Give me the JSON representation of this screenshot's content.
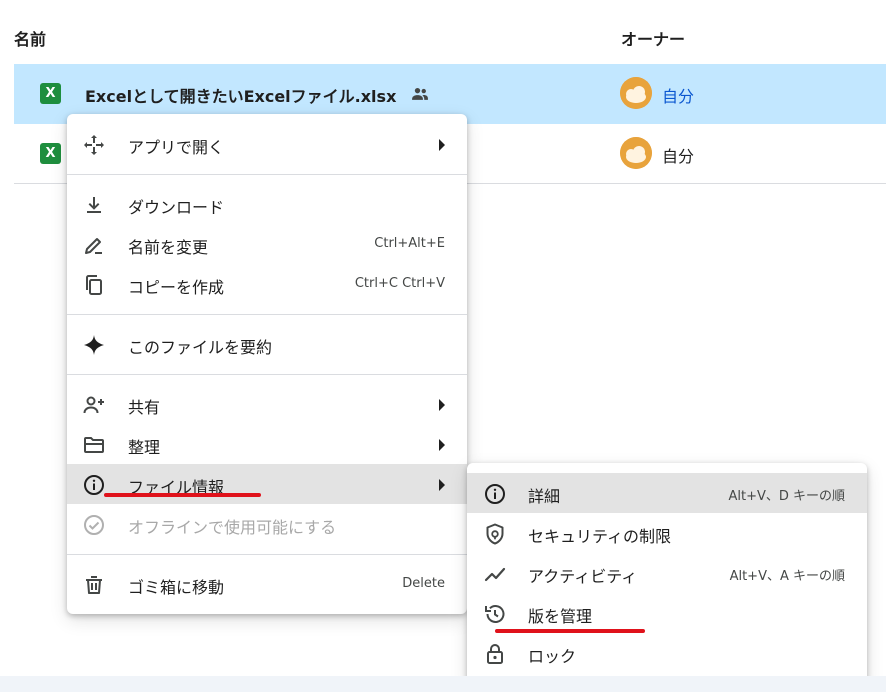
{
  "header": {
    "name_label": "名前",
    "owner_label": "オーナー"
  },
  "rows": [
    {
      "icon_letter": "X",
      "file_name": "Excelとして開きたいExcelファイル.xlsx",
      "owner": "自分",
      "selected": true
    },
    {
      "icon_letter": "X",
      "file_name": "",
      "owner": "自分",
      "selected": false
    }
  ],
  "context_menu": {
    "items": [
      {
        "label": "アプリで開く",
        "shortcut": "",
        "icon": "open-with-icon",
        "submenu": true
      },
      {
        "label": "ダウンロード",
        "shortcut": "",
        "icon": "download-icon"
      },
      {
        "label": "名前を変更",
        "shortcut": "Ctrl+Alt+E",
        "icon": "rename-icon"
      },
      {
        "label": "コピーを作成",
        "shortcut": "Ctrl+C Ctrl+V",
        "icon": "copy-icon"
      },
      {
        "label": "このファイルを要約",
        "shortcut": "",
        "icon": "sparkle-icon"
      },
      {
        "label": "共有",
        "shortcut": "",
        "icon": "person-add-icon",
        "submenu": true
      },
      {
        "label": "整理",
        "shortcut": "",
        "icon": "folder-icon",
        "submenu": true
      },
      {
        "label": "ファイル情報",
        "shortcut": "",
        "icon": "info-icon",
        "submenu": true
      },
      {
        "label": "オフラインで使用可能にする",
        "shortcut": "",
        "icon": "offline-check-icon",
        "disabled": true
      },
      {
        "label": "ゴミ箱に移動",
        "shortcut": "Delete",
        "icon": "trash-icon"
      }
    ]
  },
  "submenu": {
    "items": [
      {
        "label": "詳細",
        "shortcut": "Alt+V、D キーの順",
        "icon": "info-icon"
      },
      {
        "label": "セキュリティの制限",
        "shortcut": "",
        "icon": "shield-lock-icon"
      },
      {
        "label": "アクティビティ",
        "shortcut": "Alt+V、A キーの順",
        "icon": "activity-icon"
      },
      {
        "label": "版を管理",
        "shortcut": "",
        "icon": "history-icon"
      },
      {
        "label": "ロック",
        "shortcut": "",
        "icon": "lock-icon"
      }
    ]
  },
  "colors": {
    "selected_row": "#c2e7ff",
    "highlight": "#e3e3e3",
    "annotation_red": "#e0121b",
    "excel_green": "#1e8e3e",
    "owner_link": "#0b57d0"
  }
}
